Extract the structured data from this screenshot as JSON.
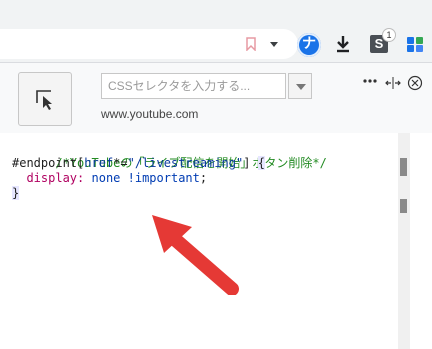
{
  "toolbar": {
    "icons": [
      "bookmark-icon",
      "dropdown-icon",
      "extension-avatar",
      "download-icon",
      "stylus-icon",
      "extensions-puzzle-icon"
    ],
    "extension_avatar_letter": "ナ",
    "stylus_letter": "S",
    "stylus_badge": "1"
  },
  "popup": {
    "selector_placeholder": "CSSセレクタを入力する...",
    "domain": "www.youtube.com",
    "header_icons": [
      "more-icon",
      "resize-icon",
      "close-icon"
    ],
    "code": {
      "comment": "/*YouTubeの「ライブ配信を開始」ボタン削除*/",
      "selector_id": "#endpoint",
      "attr_open": "[",
      "attr_name": "href",
      "attr_op": "*=",
      "attr_value": "\"/livestreaming\"",
      "attr_close": "]",
      "brace_open": "{",
      "property": "display",
      "colon": ":",
      "value": "none !important",
      "semicolon": ";",
      "brace_close": "}"
    }
  },
  "colors": {
    "annotation_arrow": "#e53935",
    "comment": "#228b22",
    "accent": "#1a73e8"
  }
}
